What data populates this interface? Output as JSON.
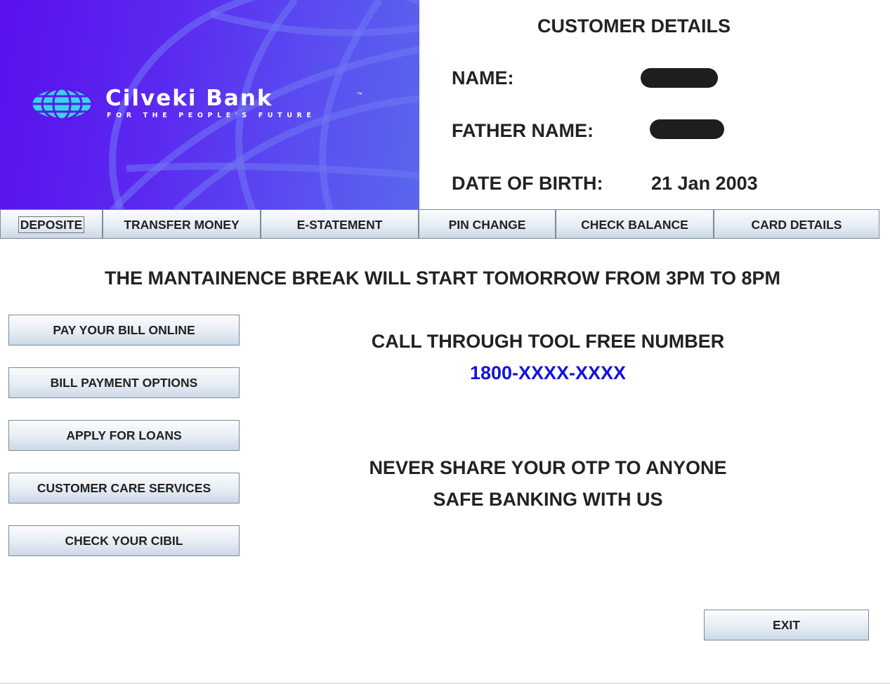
{
  "banner": {
    "bank_name": "Cilveki Bank",
    "trademark": "™",
    "tagline": "FOR THE PEOPLE'S FUTURE",
    "gradient_colors": [
      "#5a10ec",
      "#5a66ee"
    ]
  },
  "customer": {
    "title": "CUSTOMER DETAILS",
    "name_label": "NAME:",
    "name_value": "",
    "father_label": "FATHER NAME:",
    "father_value": "",
    "dob_label": "DATE OF BIRTH:",
    "dob_value": "21 Jan 2003"
  },
  "tabs": [
    {
      "label": "DEPOSITE"
    },
    {
      "label": "TRANSFER MONEY"
    },
    {
      "label": "E-STATEMENT"
    },
    {
      "label": "PIN CHANGE"
    },
    {
      "label": "CHECK BALANCE"
    },
    {
      "label": "CARD DETAILS"
    }
  ],
  "notices": {
    "maintenance": "THE MANTAINENCE BREAK WILL START TOMORROW FROM 3PM TO 8PM",
    "call_label": "CALL THROUGH TOOL FREE NUMBER",
    "phone": "1800-XXXX-XXXX",
    "phone_color": "#1414d8",
    "otp_warning": "NEVER SHARE YOUR OTP TO ANYONE",
    "safe_banking": "SAFE BANKING WITH US"
  },
  "side_buttons": [
    {
      "label": "PAY YOUR BILL ONLINE"
    },
    {
      "label": "BILL PAYMENT OPTIONS"
    },
    {
      "label": "APPLY FOR LOANS"
    },
    {
      "label": "CUSTOMER CARE SERVICES"
    },
    {
      "label": "CHECK YOUR CIBIL"
    }
  ],
  "exit_label": "EXIT"
}
